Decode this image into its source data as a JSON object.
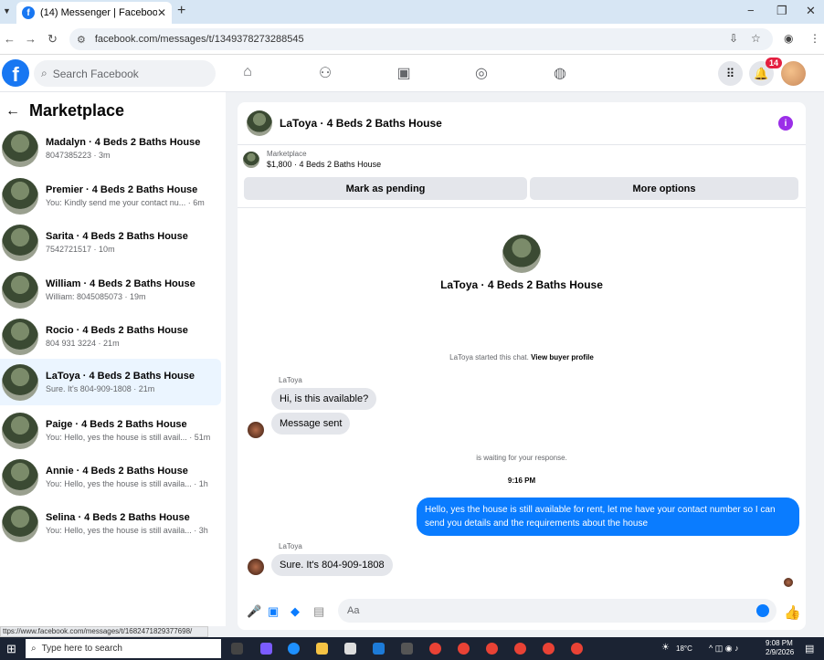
{
  "browser": {
    "tab_title": "(14) Messenger | Facebook",
    "url": "facebook.com/messages/t/1349378273288545",
    "new_tab": "+",
    "close_tab": "✕",
    "minimize": "−",
    "maximize": "❐",
    "close_window": "✕"
  },
  "fb": {
    "search_placeholder": "Search Facebook",
    "notification_count": "14"
  },
  "sidebar": {
    "title": "Marketplace",
    "conversations": [
      {
        "name": "Madalyn · 4 Beds 2 Baths House",
        "preview": "8047385223 · 3m"
      },
      {
        "name": "Premier · 4 Beds 2 Baths House",
        "preview": "You: Kindly send me your contact nu... · 6m"
      },
      {
        "name": "Sarita · 4 Beds 2 Baths House",
        "preview": "7542721517 · 10m"
      },
      {
        "name": "William · 4 Beds 2 Baths House",
        "preview": "William: 8045085073 · 19m"
      },
      {
        "name": "Rocio · 4 Beds 2 Baths House",
        "preview": "804 931 3224 · 21m"
      },
      {
        "name": "LaToya · 4 Beds 2 Baths House",
        "preview": "Sure. It's 804-909-1808 · 21m"
      },
      {
        "name": "Paige · 4 Beds 2 Baths House",
        "preview": "You: Hello, yes the house is still avail... · 51m"
      },
      {
        "name": "Annie · 4 Beds 2 Baths House",
        "preview": "You: Hello, yes the house is still availa... · 1h"
      },
      {
        "name": "Selina · 4 Beds 2 Baths House",
        "preview": "You: Hello, yes the house is still availa... · 3h"
      }
    ]
  },
  "chat": {
    "title": "LaToya · 4 Beds 2 Baths House",
    "marketplace_label": "Marketplace",
    "listing": "$1,800 · 4 Beds 2 Baths House",
    "mark_pending": "Mark as pending",
    "more_options": "More options",
    "center_name": "LaToya · 4 Beds 2 Baths House",
    "started_text": "LaToya started this chat.",
    "view_profile": "View buyer profile",
    "sender1": "LaToya",
    "msg1": "Hi, is this available?",
    "msg2": "Message sent",
    "waiting": "is waiting for your response.",
    "time": "9:16 PM",
    "my_msg": "Hello, yes the house is still available for rent, let me have your contact number so I can send you details and the requirements about the house",
    "sender2": "LaToya",
    "msg3": "Sure. It's 804-909-1808",
    "composer_placeholder": "Aa"
  },
  "status_url": "ttps://www.facebook.com/messages/t/1682471829377698/",
  "taskbar": {
    "search": "Type here to search",
    "temp": "18°C",
    "time": "9:08 PM",
    "date": "2/9/2026"
  }
}
